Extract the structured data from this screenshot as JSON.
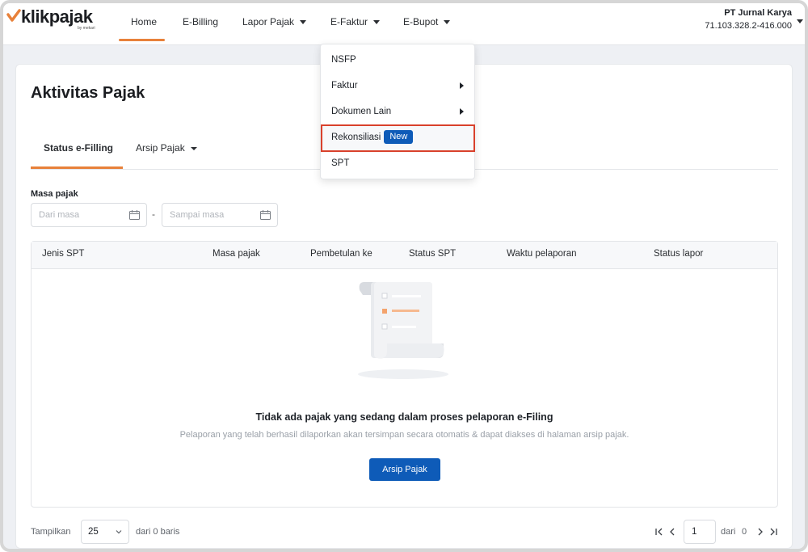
{
  "brand": {
    "name": "klikpajak",
    "sub": "by mekari",
    "accent": "#e8813a",
    "primary": "#0e5bb8"
  },
  "nav": {
    "items": [
      {
        "label": "Home"
      },
      {
        "label": "E-Billing"
      },
      {
        "label": "Lapor Pajak"
      },
      {
        "label": "E-Faktur"
      },
      {
        "label": "E-Bupot"
      }
    ],
    "active": "Home"
  },
  "company": {
    "name": "PT Jurnal Karya",
    "npwp": "71.103.328.2-416.000"
  },
  "efaktur_menu": {
    "items": [
      {
        "label": "NSFP"
      },
      {
        "label": "Faktur"
      },
      {
        "label": "Dokumen Lain"
      },
      {
        "label": "Rekonsiliasi",
        "badge": "New"
      },
      {
        "label": "SPT"
      }
    ]
  },
  "page": {
    "title": "Aktivitas Pajak",
    "tabs": [
      {
        "label": "Status e-Filling"
      },
      {
        "label": "Arsip Pajak"
      }
    ]
  },
  "filter": {
    "label": "Masa pajak",
    "from_placeholder": "Dari masa",
    "separator": "-",
    "to_placeholder": "Sampai masa"
  },
  "table": {
    "columns": [
      "Jenis SPT",
      "Masa pajak",
      "Pembetulan ke",
      "Status SPT",
      "Waktu pelaporan",
      "Status lapor"
    ]
  },
  "empty_state": {
    "title": "Tidak ada pajak yang sedang dalam proses pelaporan e-Filing",
    "description": "Pelaporan yang telah berhasil dilaporkan akan tersimpan secara otomatis & dapat diakses di halaman arsip pajak.",
    "button": "Arsip Pajak"
  },
  "footer": {
    "show_label": "Tampilkan",
    "per_page": "25",
    "rows_label": "dari 0 baris",
    "page": "1",
    "page_of_label": "dari",
    "total_pages": "0"
  }
}
